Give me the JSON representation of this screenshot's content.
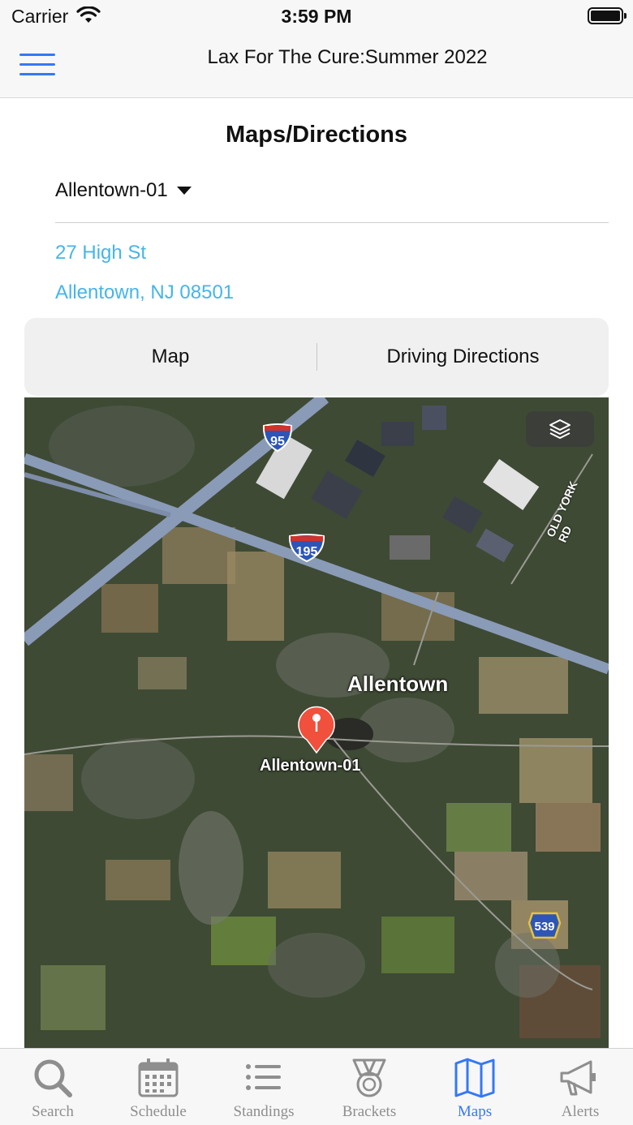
{
  "status_bar": {
    "carrier": "Carrier",
    "time": "3:59 PM"
  },
  "nav": {
    "title": "Lax For The Cure:Summer 2022",
    "accent_color": "#3478f6"
  },
  "page": {
    "title": "Maps/Directions",
    "location_select": "Allentown-01",
    "address_line1": "27 High St",
    "address_line2": "Allentown, NJ 08501",
    "link_color": "#45b5ea"
  },
  "segments": {
    "map": "Map",
    "directions": "Driving Directions"
  },
  "map": {
    "town_label": "Allentown",
    "pin_label": "Allentown-01",
    "road_label": "OLD YORK RD",
    "shields": {
      "i95": "95",
      "i195": "195",
      "cr539": "539"
    },
    "pin_color": "#f0503c"
  },
  "tabs": [
    {
      "label": "Search",
      "icon": "search-icon"
    },
    {
      "label": "Schedule",
      "icon": "calendar-icon"
    },
    {
      "label": "Standings",
      "icon": "list-icon"
    },
    {
      "label": "Brackets",
      "icon": "medal-icon"
    },
    {
      "label": "Maps",
      "icon": "map-icon",
      "active": true
    },
    {
      "label": "Alerts",
      "icon": "megaphone-icon"
    }
  ]
}
